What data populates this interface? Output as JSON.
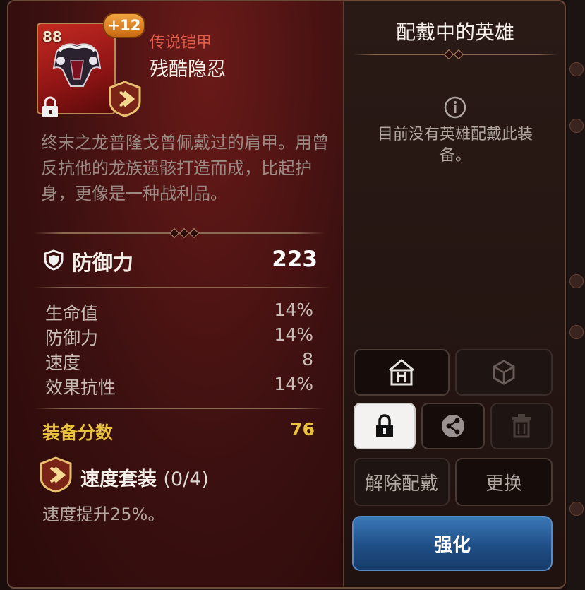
{
  "item": {
    "level": "88",
    "enhance": "+12",
    "grade": "传说铠甲",
    "name": "残酷隐忍",
    "description": "终末之龙普隆戈曾佩戴过的肩甲。用曾反抗他的龙族遗骸打造而成，比起护身，更像是一种战利品。",
    "locked": true
  },
  "main_stat": {
    "label": "防御力",
    "value": "223",
    "icon": "shield-icon"
  },
  "sub_stats": [
    {
      "label": "生命值",
      "value": "14%"
    },
    {
      "label": "防御力",
      "value": "14%"
    },
    {
      "label": "速度",
      "value": "8"
    },
    {
      "label": "效果抗性",
      "value": "14%"
    }
  ],
  "gear_score": {
    "label": "装备分数",
    "value": "76"
  },
  "set": {
    "name": "速度套装",
    "count": "(0/4)",
    "description": "速度提升25%。"
  },
  "equipped_panel": {
    "title": "配戴中的英雄",
    "message": "目前没有英雄配戴此装备。"
  },
  "actions": {
    "unequip": "解除配戴",
    "replace": "更换",
    "enhance": "强化"
  },
  "colors": {
    "grade": "#e05a4a",
    "gear_score": "#e8c23c",
    "enhance_button": "#2a5e9a",
    "badge": "#e8962c"
  }
}
